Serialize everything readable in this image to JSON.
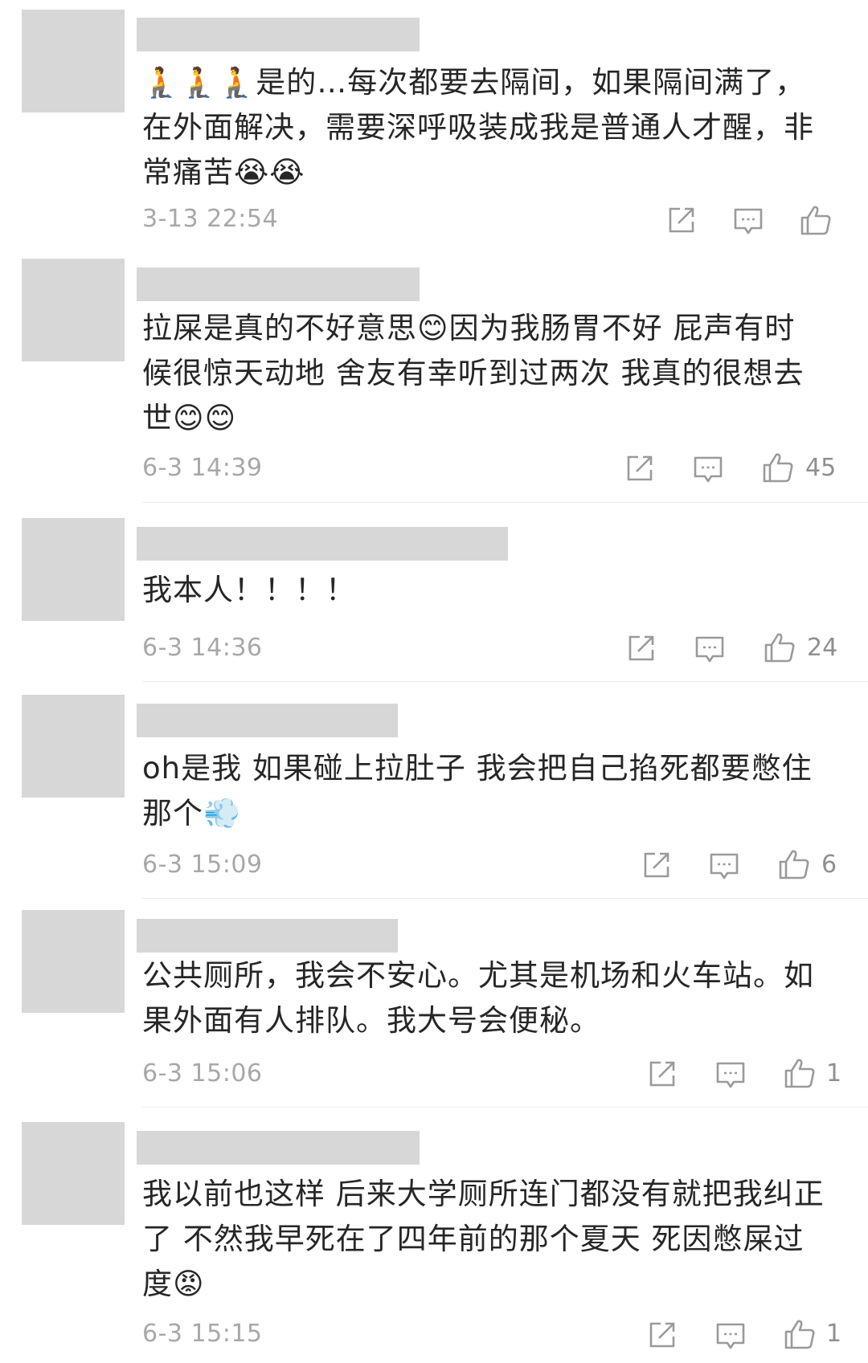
{
  "comments": [
    {
      "text_lines": [
        "🧎🧎🧎是的…每次都要去隔间，如果隔间满了，",
        "在外面解决，需要深呼吸装成我是普通人才醒，非",
        "常痛苦😭😭"
      ],
      "date": "3-13 22:54",
      "likes": ""
    },
    {
      "text_lines": [
        "拉屎是真的不好意思😊因为我肠胃不好 屁声有时",
        "候很惊天动地 舍友有幸听到过两次 我真的很想去",
        "世😊😊"
      ],
      "date": "6-3 14:39",
      "likes": "45"
    },
    {
      "text_lines": [
        "我本人！！！！"
      ],
      "date": "6-3 14:36",
      "likes": "24"
    },
    {
      "text_lines": [
        "oh是我  如果碰上拉肚子 我会把自己掐死都要憋住",
        "那个💨"
      ],
      "date": "6-3 15:09",
      "likes": "6"
    },
    {
      "text_lines": [
        "公共厕所，我会不安心。尤其是机场和火车站。如",
        "果外面有人排队。我大号会便秘。"
      ],
      "date": "6-3 15:06",
      "likes": "1"
    },
    {
      "text_lines": [
        "我以前也这样 后来大学厕所连门都没有就把我纠正",
        "了 不然我早死在了四年前的那个夏天 死因憋屎过",
        "度😡"
      ],
      "date": "6-3 15:15",
      "likes": "1"
    }
  ],
  "icons": {
    "share": "share-icon",
    "reply": "comment-icon",
    "like": "thumbs-up-icon"
  },
  "colors": {
    "placeholder": "#d7d7d7",
    "text": "#262626",
    "meta": "#a8a8a8",
    "icon": "#9a9a9a"
  }
}
